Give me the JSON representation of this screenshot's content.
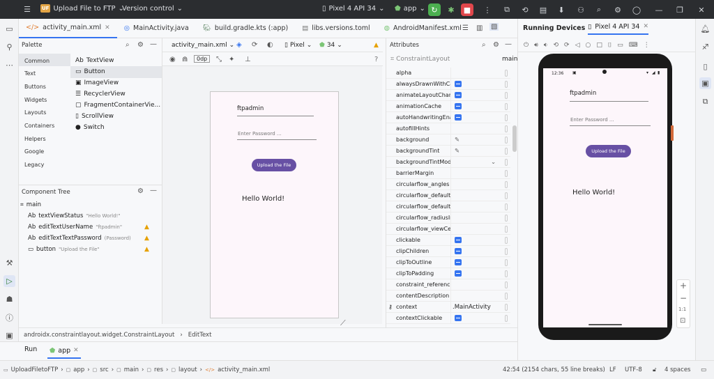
{
  "titlebar": {
    "project_badge": "UF",
    "project": "Upload File to FTP",
    "vcs": "Version control",
    "device": "Pixel 4 API 34",
    "run_config": "app"
  },
  "tabs": [
    {
      "label": "activity_main.xml",
      "icon": "xml-icon"
    },
    {
      "label": "MainActivity.java",
      "icon": "java-class-icon"
    },
    {
      "label": "build.gradle.kts (:app)",
      "icon": "gradle-icon"
    },
    {
      "label": "libs.versions.toml",
      "icon": "toml-icon"
    },
    {
      "label": "AndroidManifest.xml",
      "icon": "manifest-icon"
    }
  ],
  "palette": {
    "title": "Palette",
    "categories": [
      "Common",
      "Text",
      "Buttons",
      "Widgets",
      "Layouts",
      "Containers",
      "Helpers",
      "Google",
      "Legacy"
    ],
    "items": [
      {
        "prefix": "Ab",
        "label": "TextView"
      },
      {
        "prefix": "▭",
        "label": "Button"
      },
      {
        "prefix": "▣",
        "label": "ImageView"
      },
      {
        "prefix": "☰",
        "label": "RecyclerView"
      },
      {
        "prefix": "▢",
        "label": "FragmentContainerVie..."
      },
      {
        "prefix": "▯",
        "label": "ScrollView"
      },
      {
        "prefix": "●",
        "label": "Switch"
      }
    ]
  },
  "component_tree": {
    "title": "Component Tree",
    "root": "main",
    "children": [
      {
        "prefix": "Ab",
        "name": "textViewStatus",
        "hint": "\"Hello World!\"",
        "warn": false
      },
      {
        "prefix": "Ab",
        "name": "editTextUserName",
        "hint": "\"ftpadmin\"",
        "warn": true
      },
      {
        "prefix": "Ab",
        "name": "editTextTextPassword",
        "hint": "(Password)",
        "warn": true
      },
      {
        "prefix": "▭",
        "name": "button",
        "hint": "\"Upload the File\"",
        "warn": true
      }
    ]
  },
  "design_toolbar": {
    "file": "activity_main.xml",
    "device": "Pixel",
    "api": "34",
    "offset": "0dp"
  },
  "app_ui": {
    "username": "ftpadmin",
    "password_placeholder": "Enter Password ...",
    "button": "Upload the File",
    "status": "Hello World!"
  },
  "attributes": {
    "title": "Attributes",
    "layout": "ConstraintLayout",
    "id": "main",
    "rows": [
      {
        "name": "alpha",
        "type": "empty",
        "value": ""
      },
      {
        "name": "alwaysDrawnWithCa...",
        "type": "check",
        "value": ""
      },
      {
        "name": "animateLayoutChan...",
        "type": "check",
        "value": ""
      },
      {
        "name": "animationCache",
        "type": "check",
        "value": ""
      },
      {
        "name": "autoHandwritingEna...",
        "type": "check",
        "value": ""
      },
      {
        "name": "autofillHints",
        "type": "empty",
        "value": ""
      },
      {
        "name": "background",
        "type": "picker",
        "value": ""
      },
      {
        "name": "backgroundTint",
        "type": "picker",
        "value": ""
      },
      {
        "name": "backgroundTintMode",
        "type": "dropdown",
        "value": ""
      },
      {
        "name": "barrierMargin",
        "type": "empty",
        "value": ""
      },
      {
        "name": "circularflow_angles",
        "type": "empty",
        "value": ""
      },
      {
        "name": "circularflow_defaultA...",
        "type": "empty",
        "value": ""
      },
      {
        "name": "circularflow_defaultR...",
        "type": "empty",
        "value": ""
      },
      {
        "name": "circularflow_radiusIn...",
        "type": "empty",
        "value": ""
      },
      {
        "name": "circularflow_viewCen...",
        "type": "empty",
        "value": ""
      },
      {
        "name": "clickable",
        "type": "check",
        "value": ""
      },
      {
        "name": "clipChildren",
        "type": "check",
        "value": ""
      },
      {
        "name": "clipToOutline",
        "type": "check",
        "value": ""
      },
      {
        "name": "clipToPadding",
        "type": "check",
        "value": ""
      },
      {
        "name": "constraint_reference...",
        "type": "empty",
        "value": ""
      },
      {
        "name": "contentDescription",
        "type": "empty",
        "value": ""
      },
      {
        "name": "context",
        "type": "text",
        "value": ".MainActivity"
      },
      {
        "name": "contextClickable",
        "type": "check",
        "value": ""
      }
    ]
  },
  "running_devices": {
    "title": "Running Devices",
    "tab": "Pixel 4 API 34",
    "clock": "12:36",
    "zoom_label": "1:1"
  },
  "breadcrumb": [
    "androidx.constraintlayout.widget.ConstraintLayout",
    "EditText"
  ],
  "runbar": {
    "label": "Run",
    "config": "app"
  },
  "statusbar": {
    "path": [
      "UploadFiletoFTP",
      "app",
      "src",
      "main",
      "res",
      "layout",
      "activity_main.xml"
    ],
    "position": "42:54 (2154 chars, 55 line breaks)",
    "line_sep": "LF",
    "encoding": "UTF-8",
    "indent": "4 spaces"
  }
}
